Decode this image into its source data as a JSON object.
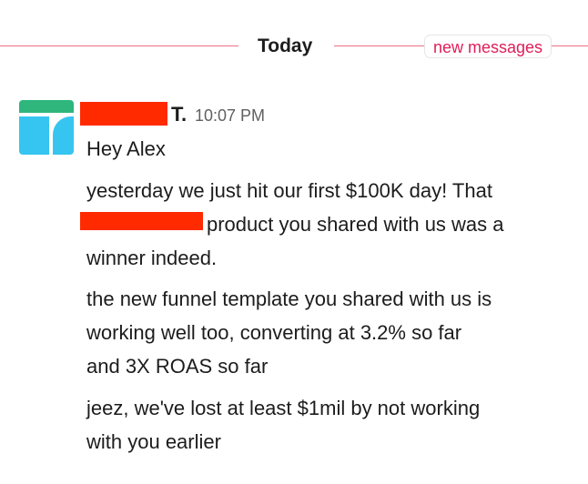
{
  "divider": {
    "day_label": "Today",
    "new_messages_label": "new messages"
  },
  "message": {
    "author_visible_suffix": "T.",
    "timestamp": "10:07 PM",
    "avatar_colors": {
      "top": "#2eb67d",
      "bottom": "#36c5f0"
    },
    "redaction_color": "#ff2a00",
    "lines": [
      "Hey Alex",
      "yesterday we just hit our first $100K day! That",
      "product you shared with us was a",
      "winner indeed.",
      "the new funnel template you shared with us is",
      "working well too, converting at 3.2% so far",
      "and 3X ROAS so far",
      "jeez, we've lost at least $1mil by not working",
      "with you earlier"
    ]
  }
}
